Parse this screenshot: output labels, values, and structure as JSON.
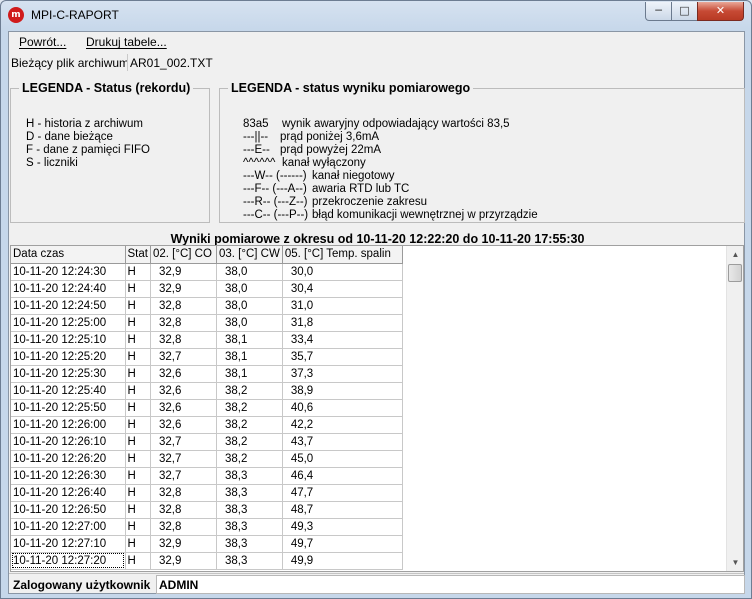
{
  "window": {
    "title": "MPI-C-RAPORT"
  },
  "menu": {
    "back": "Powrót...",
    "print": "Drukuj tabele..."
  },
  "file": {
    "label": "Bieżący plik archiwum",
    "value": "AR01_002.TXT"
  },
  "legend_status": {
    "title": "LEGENDA - Status (rekordu)",
    "items": [
      "H - historia z archiwum",
      "D - dane bieżące",
      "F - dane z pamięci FIFO",
      "S - liczniki"
    ]
  },
  "legend_result": {
    "title": "LEGENDA - status wyniku pomiarowego",
    "items": [
      {
        "code": "83a5",
        "desc": "wynik awaryjny odpowiadający wartości 83,5"
      },
      {
        "code": "---||--",
        "desc": "prąd poniżej 3,6mA"
      },
      {
        "code": "---E--",
        "desc": "prąd powyżej 22mA"
      },
      {
        "code": "^^^^^^",
        "desc": "kanał wyłączony"
      },
      {
        "code": "---W-- (------)",
        "desc": "kanał niegotowy"
      },
      {
        "code": "---F-- (---A--)",
        "desc": "awaria RTD lub TC"
      },
      {
        "code": "---R-- (---Z--)",
        "desc": "przekroczenie zakresu"
      },
      {
        "code": "---C-- (---P--)",
        "desc": "błąd komunikacji wewnętrznej w przyrządzie"
      }
    ]
  },
  "results": {
    "title": "Wyniki pomiarowe z okresu od 10-11-20 12:22:20 do 10-11-20 17:55:30",
    "columns": [
      "Data czas",
      "Stat",
      "02.   [°C] CO",
      "03.   [°C] CW",
      "05.   [°C] Temp. spalin"
    ],
    "rows": [
      [
        "10-11-20 12:24:30",
        "H",
        "32,9",
        "38,0",
        "30,0"
      ],
      [
        "10-11-20 12:24:40",
        "H",
        "32,9",
        "38,0",
        "30,4"
      ],
      [
        "10-11-20 12:24:50",
        "H",
        "32,8",
        "38,0",
        "31,0"
      ],
      [
        "10-11-20 12:25:00",
        "H",
        "32,8",
        "38,0",
        "31,8"
      ],
      [
        "10-11-20 12:25:10",
        "H",
        "32,8",
        "38,1",
        "33,4"
      ],
      [
        "10-11-20 12:25:20",
        "H",
        "32,7",
        "38,1",
        "35,7"
      ],
      [
        "10-11-20 12:25:30",
        "H",
        "32,6",
        "38,1",
        "37,3"
      ],
      [
        "10-11-20 12:25:40",
        "H",
        "32,6",
        "38,2",
        "38,9"
      ],
      [
        "10-11-20 12:25:50",
        "H",
        "32,6",
        "38,2",
        "40,6"
      ],
      [
        "10-11-20 12:26:00",
        "H",
        "32,6",
        "38,2",
        "42,2"
      ],
      [
        "10-11-20 12:26:10",
        "H",
        "32,7",
        "38,2",
        "43,7"
      ],
      [
        "10-11-20 12:26:20",
        "H",
        "32,7",
        "38,2",
        "45,0"
      ],
      [
        "10-11-20 12:26:30",
        "H",
        "32,7",
        "38,3",
        "46,4"
      ],
      [
        "10-11-20 12:26:40",
        "H",
        "32,8",
        "38,3",
        "47,7"
      ],
      [
        "10-11-20 12:26:50",
        "H",
        "32,8",
        "38,3",
        "48,7"
      ],
      [
        "10-11-20 12:27:00",
        "H",
        "32,8",
        "38,3",
        "49,3"
      ],
      [
        "10-11-20 12:27:10",
        "H",
        "32,9",
        "38,3",
        "49,7"
      ],
      [
        "10-11-20 12:27:20",
        "H",
        "32,9",
        "38,3",
        "49,9"
      ]
    ]
  },
  "status": {
    "label": "Zalogowany użytkownik",
    "user": "ADMIN"
  },
  "icons": {
    "app": "app-logo-icon",
    "minimize": "minimize-icon",
    "maximize": "maximize-icon",
    "close": "close-icon",
    "scroll_up": "scroll-up-icon",
    "scroll_down": "scroll-down-icon"
  }
}
